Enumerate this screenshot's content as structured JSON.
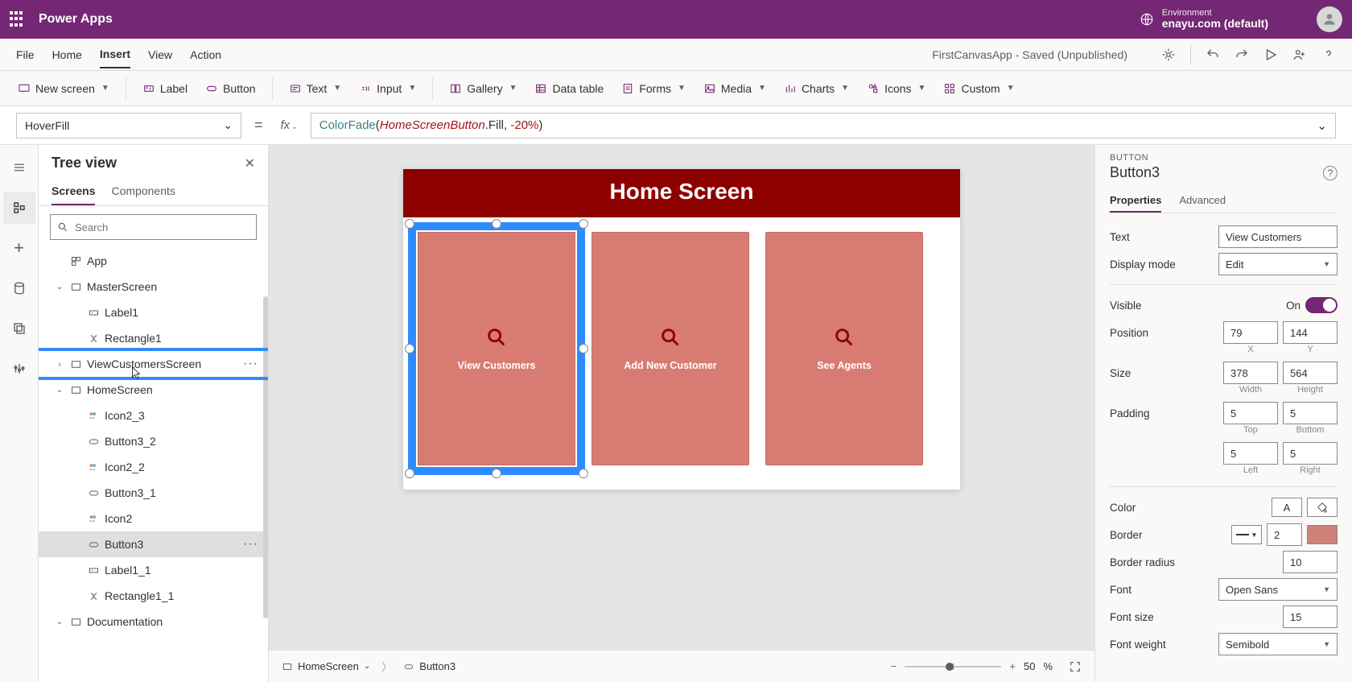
{
  "header": {
    "app_title": "Power Apps",
    "env_label": "Environment",
    "env_name": "enayu.com (default)"
  },
  "menubar": {
    "items": [
      "File",
      "Home",
      "Insert",
      "View",
      "Action"
    ],
    "active_index": 2,
    "doc_title": "FirstCanvasApp - Saved (Unpublished)"
  },
  "ribbon": {
    "new_screen": "New screen",
    "label": "Label",
    "button": "Button",
    "text": "Text",
    "input": "Input",
    "gallery": "Gallery",
    "data_table": "Data table",
    "forms": "Forms",
    "media": "Media",
    "charts": "Charts",
    "icons": "Icons",
    "custom": "Custom"
  },
  "formula": {
    "property": "HoverFill",
    "fn": "ColorFade",
    "obj": "HomeScreenButton",
    "prop": ".Fill",
    "comma": ", ",
    "num": "-20",
    "pct": "%"
  },
  "tree": {
    "title": "Tree view",
    "tabs": [
      "Screens",
      "Components"
    ],
    "active_tab": 0,
    "search_placeholder": "Search",
    "nodes": {
      "app": "App",
      "master": "MasterScreen",
      "label1": "Label1",
      "rect1": "Rectangle1",
      "viewcust": "ViewCustomersScreen",
      "home": "HomeScreen",
      "icon2_3": "Icon2_3",
      "button3_2": "Button3_2",
      "icon2_2": "Icon2_2",
      "button3_1": "Button3_1",
      "icon2": "Icon2",
      "button3": "Button3",
      "label1_1": "Label1_1",
      "rect1_1": "Rectangle1_1",
      "doc": "Documentation"
    }
  },
  "canvas": {
    "header_title": "Home Screen",
    "tiles": [
      "View Customers",
      "Add New Customer",
      "See Agents"
    ]
  },
  "breadcrumb": {
    "screen": "HomeScreen",
    "control": "Button3"
  },
  "zoom": {
    "value": "50",
    "unit": "%"
  },
  "props": {
    "category": "BUTTON",
    "name": "Button3",
    "tabs": [
      "Properties",
      "Advanced"
    ],
    "active_tab": 0,
    "text_label": "Text",
    "text_value": "View Customers",
    "display_mode_label": "Display mode",
    "display_mode_value": "Edit",
    "visible_label": "Visible",
    "visible_value": "On",
    "position_label": "Position",
    "position_x": "79",
    "position_y": "144",
    "position_x_sub": "X",
    "position_y_sub": "Y",
    "size_label": "Size",
    "size_w": "378",
    "size_h": "564",
    "size_w_sub": "Width",
    "size_h_sub": "Height",
    "padding_label": "Padding",
    "pad_t": "5",
    "pad_b": "5",
    "pad_l": "5",
    "pad_r": "5",
    "pad_t_sub": "Top",
    "pad_b_sub": "Bottom",
    "pad_l_sub": "Left",
    "pad_r_sub": "Right",
    "color_label": "Color",
    "border_label": "Border",
    "border_width": "2",
    "border_radius_label": "Border radius",
    "border_radius": "10",
    "font_label": "Font",
    "font_value": "Open Sans",
    "font_size_label": "Font size",
    "font_size": "15",
    "font_weight_label": "Font weight",
    "font_weight": "Semibold"
  }
}
